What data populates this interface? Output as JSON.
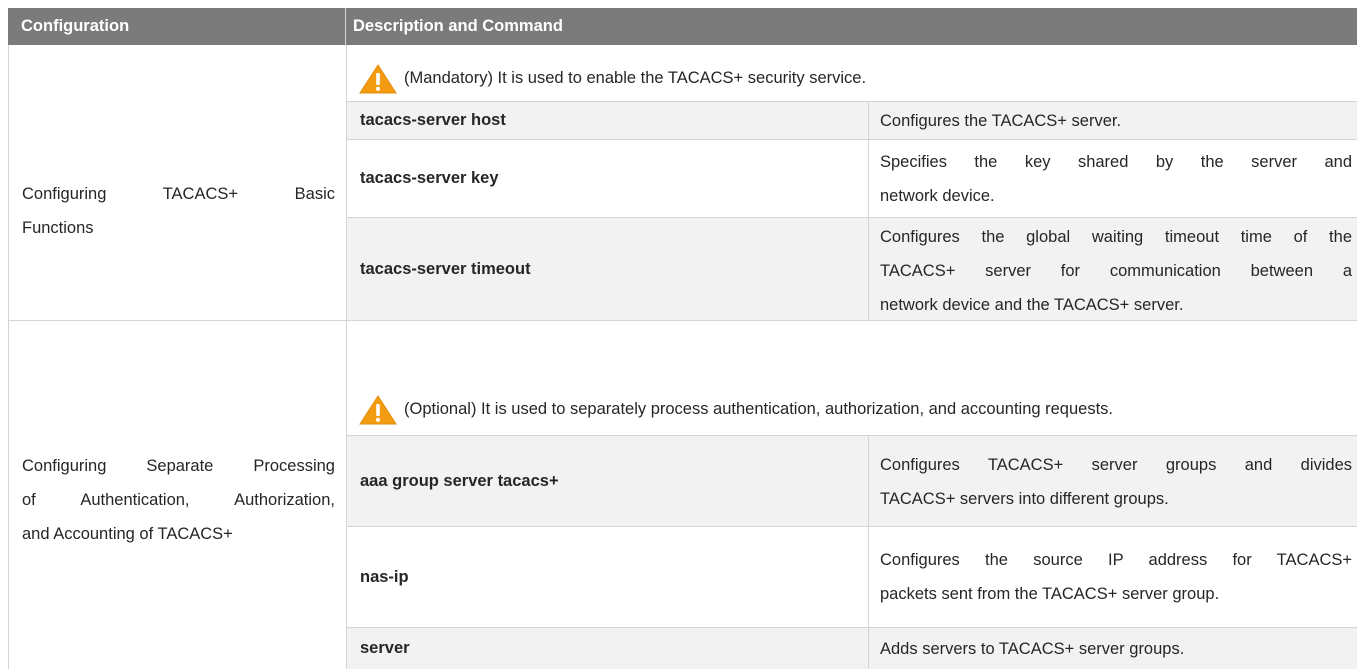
{
  "table": {
    "headers": {
      "configuration": "Configuration",
      "description": "Description and Command"
    },
    "sections": [
      {
        "configuration_lines": [
          "Configuring TACACS+ Basic",
          "Functions"
        ],
        "note": "(Mandatory) It is used to enable the TACACS+ security service.",
        "rows": [
          {
            "command": "tacacs-server host",
            "description_lines": [
              "Configures the TACACS+ server."
            ]
          },
          {
            "command": "tacacs-server key",
            "description_lines": [
              "Specifies the key shared by the server and",
              "network device."
            ]
          },
          {
            "command": "tacacs-server timeout",
            "description_lines": [
              "Configures the global waiting timeout time of the",
              "TACACS+ server for communication between a",
              "network device and the TACACS+ server."
            ]
          }
        ]
      },
      {
        "configuration_lines": [
          "Configuring Separate Processing",
          "of Authentication, Authorization,",
          "and Accounting of TACACS+"
        ],
        "note": "(Optional) It is used to separately process authentication, authorization, and accounting requests.",
        "rows": [
          {
            "command": "aaa group server tacacs+",
            "description_lines": [
              "Configures TACACS+ server groups and divides",
              "TACACS+ servers into different groups."
            ]
          },
          {
            "command": "nas-ip",
            "description_lines": [
              "Configures the source IP address for TACACS+",
              "packets sent from the TACACS+ server group."
            ]
          },
          {
            "command": "server",
            "description_lines": [
              "Adds servers to TACACS+ server groups."
            ]
          }
        ]
      }
    ]
  },
  "colors": {
    "header_bg": "#7b7b7b",
    "row_alt_bg": "#f2f2f2",
    "warning_fill": "#f39c12"
  },
  "icons": {
    "note": "warning-triangle-icon"
  }
}
